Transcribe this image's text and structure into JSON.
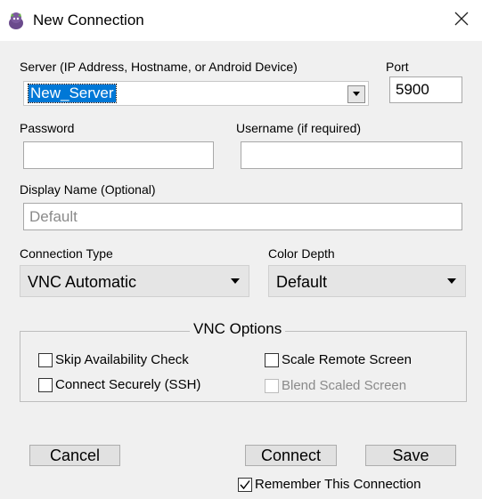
{
  "window": {
    "title": "New Connection",
    "app_icon": "vnc-app-icon",
    "close_icon": "close-icon"
  },
  "server": {
    "label": "Server (IP Address, Hostname, or Android Device)",
    "value": "New_Server",
    "dropdown_icon": "chevron-down-icon"
  },
  "port": {
    "label": "Port",
    "value": "5900"
  },
  "password": {
    "label": "Password",
    "value": ""
  },
  "username": {
    "label": "Username (if required)",
    "value": ""
  },
  "display_name": {
    "label": "Display Name (Optional)",
    "placeholder": "Default",
    "value": ""
  },
  "connection_type": {
    "label": "Connection Type",
    "selected": "VNC Automatic"
  },
  "color_depth": {
    "label": "Color Depth",
    "selected": "Default"
  },
  "vnc_options": {
    "title": "VNC Options",
    "skip_availability": {
      "label": "Skip Availability Check",
      "checked": false
    },
    "connect_securely": {
      "label": "Connect Securely (SSH)",
      "checked": false
    },
    "scale_remote": {
      "label": "Scale Remote Screen",
      "checked": false
    },
    "blend_scaled": {
      "label": "Blend Scaled Screen",
      "checked": false,
      "enabled": false
    }
  },
  "buttons": {
    "cancel": "Cancel",
    "connect": "Connect",
    "save": "Save"
  },
  "remember": {
    "label": "Remember This Connection",
    "checked": true
  },
  "colors": {
    "selection": "#0078d7",
    "background": "#f0f0f0"
  }
}
